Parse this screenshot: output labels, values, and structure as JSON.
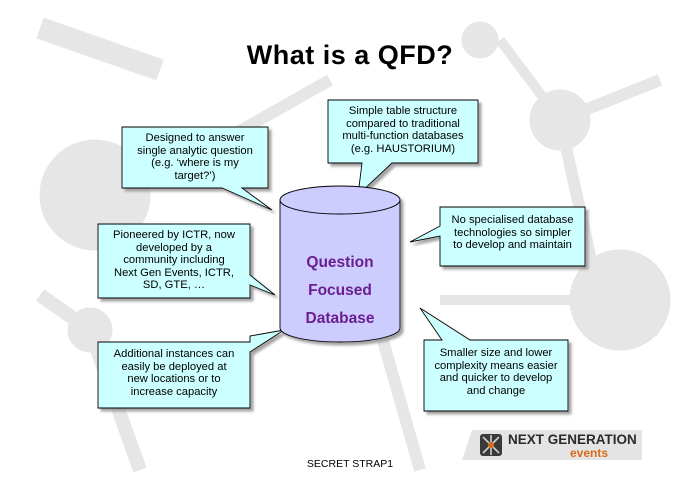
{
  "title": "What is a QFD?",
  "database": {
    "lines": [
      "Question",
      "Focused",
      "Database"
    ]
  },
  "callouts": {
    "top_left": [
      "Designed to answer",
      "single analytic question",
      "(e.g. ‘where is my",
      "target?’)"
    ],
    "top_center": [
      "Simple table structure",
      "compared to traditional",
      "multi-function databases",
      "(e.g. HAUSTORIUM)"
    ],
    "right_upper": [
      "No specialised database",
      "technologies so simpler",
      "to develop and maintain"
    ],
    "left_middle": [
      "Pioneered by ICTR, now",
      "developed by a",
      "community including",
      "Next Gen Events, ICTR,",
      "SD, GTE, …"
    ],
    "left_lower": [
      "Additional instances can",
      "easily be deployed at",
      "new locations or to",
      "increase capacity"
    ],
    "right_lower": [
      "Smaller size and lower",
      "complexity means easier",
      "and quicker to develop",
      "and change"
    ]
  },
  "footer": "SECRET STRAP1",
  "logo": {
    "line1": "NEXT GENERATION",
    "line2": "events"
  },
  "colors": {
    "callout_fill": "#ccffff",
    "database_fill": "#ccccff",
    "database_text": "#6b1f8f",
    "logo_accent": "#d96a1a"
  }
}
